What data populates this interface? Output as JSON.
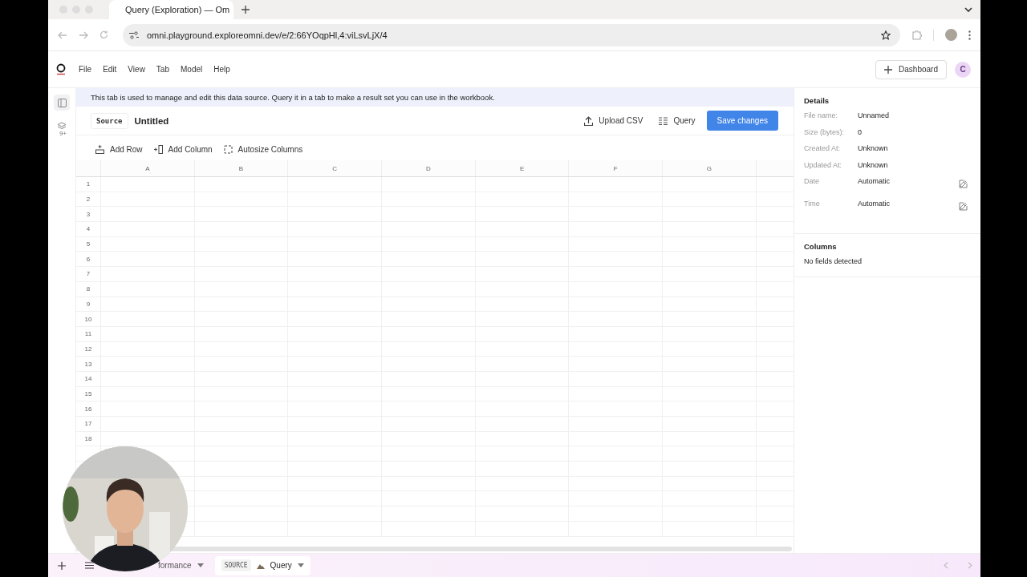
{
  "browser": {
    "tabs": [
      {
        "title": "Query (Exploration) — Om",
        "selected": true
      }
    ],
    "url": "omni.playground.exploreomni.dev/e/2:66YOqpHl,4:viLsvLjX/4"
  },
  "menu": [
    "File",
    "Edit",
    "View",
    "Tab",
    "Model",
    "Help"
  ],
  "header": {
    "button": "Dashboard",
    "avatar": "C"
  },
  "rail": {
    "layers_badge": "9+"
  },
  "banner": "This tab is used to manage and edit this data source. Query it in a tab to make a result set you can use in the workbook.",
  "source": {
    "badge": "Source",
    "title": "Untitled"
  },
  "actions": [
    {
      "label": "Upload CSV",
      "kind": "upload"
    },
    {
      "label": "Query",
      "kind": "query"
    },
    {
      "label": "Save changes",
      "kind": "primary"
    }
  ],
  "toolbar": [
    {
      "label": "Add Row",
      "kind": "row"
    },
    {
      "label": "Add Column",
      "kind": "column"
    },
    {
      "label": "Autosize Columns",
      "kind": "autosize"
    }
  ],
  "grid": {
    "columns": [
      "A",
      "B",
      "C",
      "D",
      "E",
      "F",
      "G"
    ],
    "rows": [
      "1",
      "2",
      "3",
      "4",
      "5",
      "6",
      "7",
      "8",
      "9",
      "10",
      "11",
      "12",
      "13",
      "14",
      "15",
      "16",
      "17",
      "18"
    ]
  },
  "details": {
    "title": "Details",
    "fields": [
      {
        "label": "File name:",
        "value": "Unnamed",
        "editable": false
      },
      {
        "label": "Size (bytes):",
        "value": "0",
        "editable": false
      },
      {
        "label": "Created At:",
        "value": "Unknown",
        "editable": false
      },
      {
        "label": "Updated At:",
        "value": "Unknown",
        "editable": false
      },
      {
        "label": "Date",
        "value": "Automatic",
        "editable": true
      },
      {
        "label": "Time",
        "value": "Automatic",
        "editable": true
      }
    ]
  },
  "columns_panel": {
    "title": "Columns",
    "empty": "No fields detected"
  },
  "sheet_tabs": [
    {
      "label": "formance",
      "selected": false
    },
    {
      "badge": "SOURCE",
      "label": "Query",
      "selected": true
    }
  ],
  "webcam": {
    "kind": "picture"
  }
}
